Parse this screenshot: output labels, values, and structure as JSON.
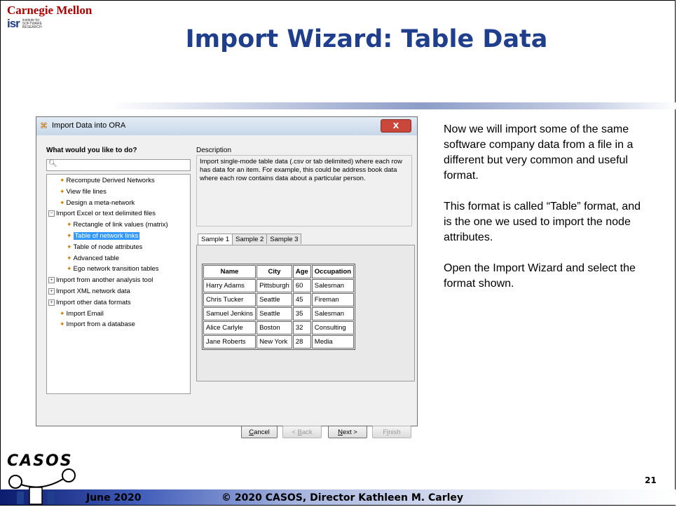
{
  "header": {
    "org_name": "Carnegie Mellon",
    "institute_mark": "isr",
    "institute_text": [
      "institute for",
      "SOFTWARE",
      "RESEARCH"
    ],
    "title": "Import Wizard: Table Data"
  },
  "dialog": {
    "title": "Import Data into ORA",
    "close_label": "X",
    "question": "What would you like to do?",
    "search": {
      "value": "",
      "placeholder": ""
    },
    "tree": [
      {
        "label": "Recompute Derived Networks",
        "level": 1,
        "icon": "wand-icon"
      },
      {
        "label": "View file lines",
        "level": 1,
        "icon": "wand-icon"
      },
      {
        "label": "Design a meta-network",
        "level": 1,
        "icon": "wand-icon"
      },
      {
        "label": "Import Excel or text delimited files",
        "level": 0,
        "icon": "collapse-icon"
      },
      {
        "label": "Rectangle of link values (matrix)",
        "level": 2,
        "icon": "wand-icon"
      },
      {
        "label": "Table of network links",
        "level": 2,
        "icon": "wand-icon",
        "selected": true
      },
      {
        "label": "Table of node attributes",
        "level": 2,
        "icon": "wand-icon"
      },
      {
        "label": "Advanced table",
        "level": 2,
        "icon": "wand-icon"
      },
      {
        "label": "Ego network transition tables",
        "level": 2,
        "icon": "wand-icon"
      },
      {
        "label": "Import from another analysis tool",
        "level": 0,
        "icon": "expand-icon"
      },
      {
        "label": "Import XML network data",
        "level": 0,
        "icon": "expand-icon"
      },
      {
        "label": "Import other data formats",
        "level": 0,
        "icon": "expand-icon"
      },
      {
        "label": "Import Email",
        "level": 1,
        "icon": "wand-icon"
      },
      {
        "label": "Import from a database",
        "level": 1,
        "icon": "wand-icon"
      }
    ],
    "description_label": "Description",
    "description": "Import single-mode table data (.csv or tab delimited) where each row has data for an item. For example, this could be address book data where each row contains data about a particular person.",
    "tabs": [
      "Sample 1",
      "Sample 2",
      "Sample 3"
    ],
    "active_tab": "Sample 1",
    "sample_table": {
      "columns": [
        "Name",
        "City",
        "Age",
        "Occupation"
      ],
      "rows": [
        [
          "Harry Adams",
          "Pittsburgh",
          "60",
          "Salesman"
        ],
        [
          "Chris Tucker",
          "Seattle",
          "45",
          "Fireman"
        ],
        [
          "Samuel Jenkins",
          "Seattle",
          "35",
          "Salesman"
        ],
        [
          "Alice Carlyle",
          "Boston",
          "32",
          "Consulting"
        ],
        [
          "Jane Roberts",
          "New York",
          "28",
          "Media"
        ]
      ]
    },
    "buttons": {
      "cancel": {
        "mnemonic": "C",
        "rest": "ancel"
      },
      "back": {
        "prefix": "< ",
        "mnemonic": "B",
        "rest": "ack"
      },
      "next": {
        "mnemonic": "N",
        "rest": "ext >"
      },
      "finish": {
        "prefix": "F",
        "mnemonic": "i",
        "rest": "nish"
      }
    }
  },
  "side_text": [
    "Now we will import some of the same software company data from a file in a different but very common and useful format.",
    "This format is called “Table” format, and is the one we used to import the node attributes.",
    "Open the Import Wizard and select the format shown."
  ],
  "footer": {
    "logo_text": "CASOS",
    "date": "June 2020",
    "copyright": "© 2020 CASOS, Director Kathleen M. Carley",
    "page_number": "21"
  },
  "colors": {
    "title": "#1f3e8c",
    "cmu_red": "#b00000",
    "selection": "#3399ff",
    "close_button": "#c9483b"
  }
}
